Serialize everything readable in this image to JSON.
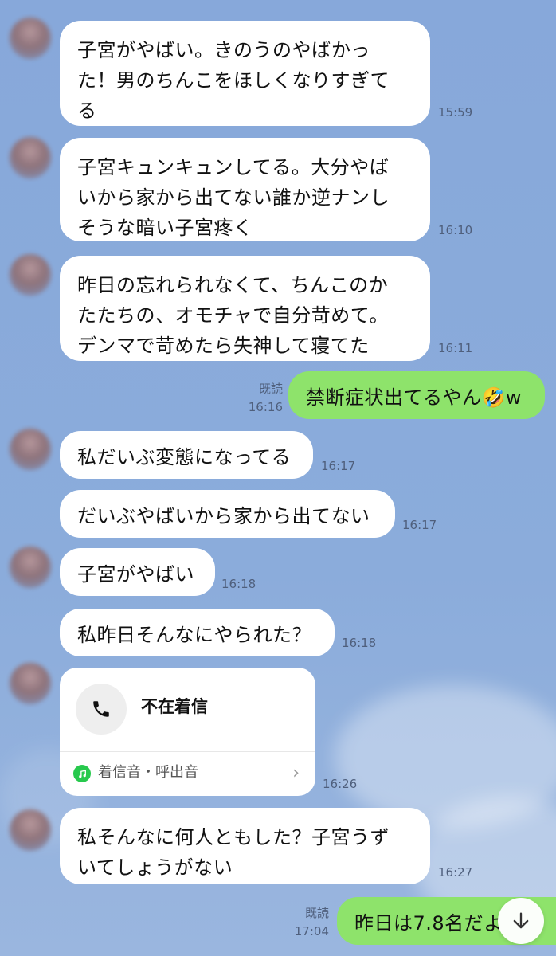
{
  "messages": [
    {
      "text": "子宮がやばい。きのうのやばかっ\nた！男のちんこをほしくなりすぎて\nる",
      "time": "15:59"
    },
    {
      "text": "子宮キュンキュンしてる。大分やば\nいから家から出てない誰か逆ナンし\nそうな暗い子宮疼く",
      "time": "16:10"
    },
    {
      "text": "昨日の忘れられなくて、ちんこのか\nたたちの、オモチャで自分苛めて。\nデンマで苛めたら失神して寝てた",
      "time": "16:11"
    },
    {
      "text": "禁断症状出てるやん🤣w",
      "time": "16:16",
      "read": "既読"
    },
    {
      "text": "私だいぶ変態になってる",
      "time": "16:17"
    },
    {
      "text": "だいぶやばいから家から出てない",
      "time": "16:17"
    },
    {
      "text": "子宮がやばい",
      "time": "16:18"
    },
    {
      "text": "私昨日そんなにやられた？",
      "time": "16:18"
    },
    {
      "call_title": "不在着信",
      "call_sub": "着信音・呼出音",
      "time": "16:26"
    },
    {
      "text": "私そんなに何人ともした？子宮うず\nいてしょうがない",
      "time": "16:27"
    },
    {
      "text": "昨日は7.8名だよ",
      "time": "17:04",
      "read": "既読"
    }
  ],
  "icons": {
    "phone": "phone-icon",
    "music": "music-note-icon",
    "chevron": "chevron-right-icon",
    "scroll": "arrow-down-icon"
  },
  "colors": {
    "background": "#8aaad8",
    "received_bubble": "#ffffff",
    "sent_bubble": "#8ee36b",
    "call_accent": "#27c94d"
  }
}
